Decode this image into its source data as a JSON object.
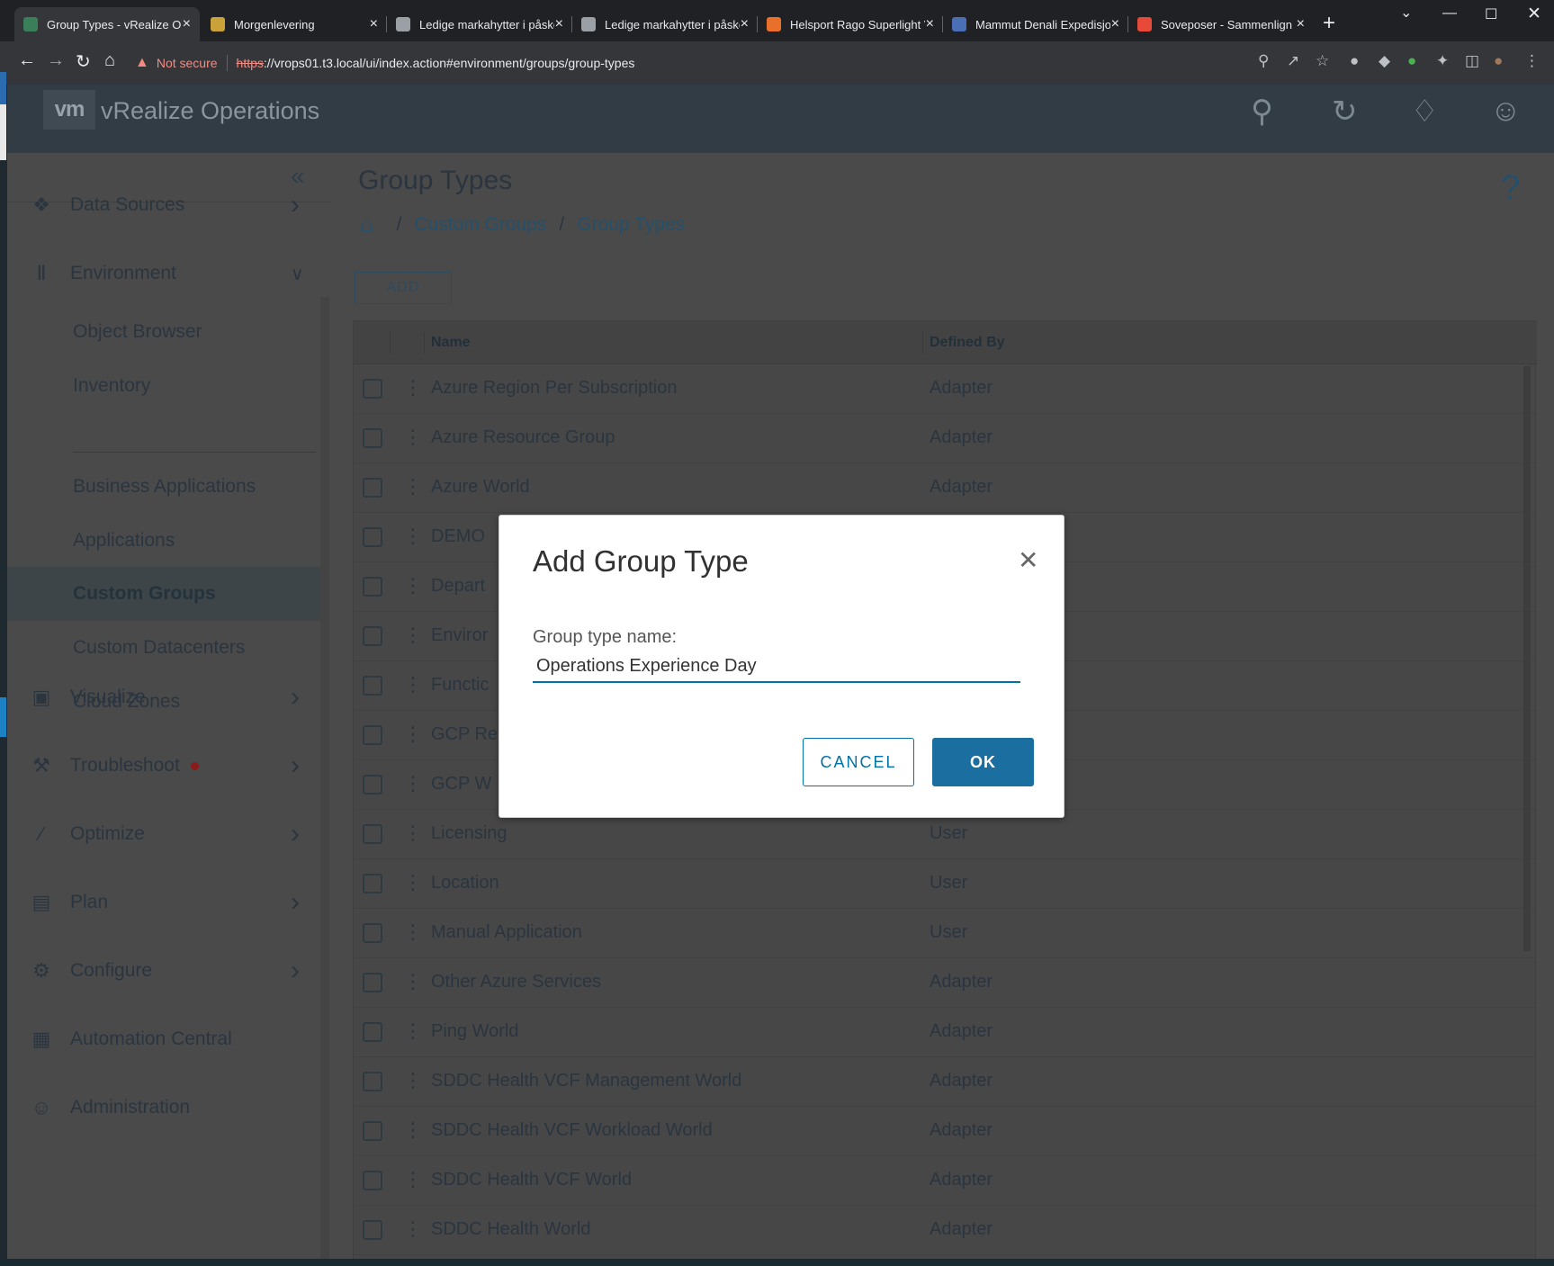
{
  "browser": {
    "tabs": [
      {
        "title": "Group Types - vRealize Op",
        "favicon_color": "#3a7f5a",
        "active": true
      },
      {
        "title": "Morgenlevering",
        "favicon_color": "#c9a23a",
        "active": false
      },
      {
        "title": "Ledige markahytter i påske",
        "favicon_color": "#9aa0a6",
        "active": false
      },
      {
        "title": "Ledige markahytter i påske",
        "favicon_color": "#9aa0a6",
        "active": false
      },
      {
        "title": "Helsport Rago Superlight V",
        "favicon_color": "#e8702a",
        "active": false
      },
      {
        "title": "Mammut Denali Expedisjon",
        "favicon_color": "#4a6fb5",
        "active": false
      },
      {
        "title": "Soveposer - Sammenlign p",
        "favicon_color": "#e84a3a",
        "active": false
      }
    ],
    "security_label": "Not secure",
    "url_scheme": "https",
    "url_rest": "://vrops01.t3.local/ui/index.action#environment/groups/group-types"
  },
  "app": {
    "logo_text": "vm",
    "title": "vRealize Operations"
  },
  "sidebar": {
    "items": [
      {
        "label": "Data Sources",
        "icon": "puzzle-icon",
        "expandable": true
      },
      {
        "label": "Environment",
        "icon": "library-icon",
        "expanded": true
      },
      {
        "label": "Visualize",
        "icon": "presentation-icon",
        "expandable": true
      },
      {
        "label": "Troubleshoot",
        "icon": "wrench-icon",
        "expandable": true,
        "alert": true
      },
      {
        "label": "Optimize",
        "icon": "wand-icon",
        "expandable": true
      },
      {
        "label": "Plan",
        "icon": "briefcase-icon",
        "expandable": true
      },
      {
        "label": "Configure",
        "icon": "gear-icon",
        "expandable": true
      },
      {
        "label": "Automation Central",
        "icon": "calendar-icon"
      },
      {
        "label": "Administration",
        "icon": "user-gear-icon"
      }
    ],
    "environment_subitems": [
      "Object Browser",
      "Inventory",
      "Business Applications",
      "Applications",
      "Custom Groups",
      "Custom Datacenters",
      "Cloud Zones"
    ],
    "active_subitem": "Custom Groups"
  },
  "page": {
    "title": "Group Types",
    "breadcrumb": [
      "Custom Groups",
      "Group Types"
    ],
    "add_label": "ADD"
  },
  "grid": {
    "columns": [
      "Name",
      "Defined By"
    ],
    "rows": [
      {
        "name": "Azure Region Per Subscription",
        "defined_by": "Adapter"
      },
      {
        "name": "Azure Resource Group",
        "defined_by": "Adapter"
      },
      {
        "name": "Azure World",
        "defined_by": "Adapter"
      },
      {
        "name": "DEMO",
        "defined_by": ""
      },
      {
        "name": "Depart",
        "defined_by": ""
      },
      {
        "name": "Enviror",
        "defined_by": ""
      },
      {
        "name": "Functic",
        "defined_by": ""
      },
      {
        "name": "GCP Re",
        "defined_by": ""
      },
      {
        "name": "GCP W",
        "defined_by": ""
      },
      {
        "name": "Licensing",
        "defined_by": "User"
      },
      {
        "name": "Location",
        "defined_by": "User"
      },
      {
        "name": "Manual Application",
        "defined_by": "User"
      },
      {
        "name": "Other Azure Services",
        "defined_by": "Adapter"
      },
      {
        "name": "Ping World",
        "defined_by": "Adapter"
      },
      {
        "name": "SDDC Health VCF Management World",
        "defined_by": "Adapter"
      },
      {
        "name": "SDDC Health VCF Workload World",
        "defined_by": "Adapter"
      },
      {
        "name": "SDDC Health VCF World",
        "defined_by": "Adapter"
      },
      {
        "name": "SDDC Health World",
        "defined_by": "Adapter"
      }
    ]
  },
  "modal": {
    "title": "Add Group Type",
    "field_label": "Group type name:",
    "field_value": "Operations Experience Day",
    "cancel_label": "CANCEL",
    "ok_label": "OK"
  }
}
